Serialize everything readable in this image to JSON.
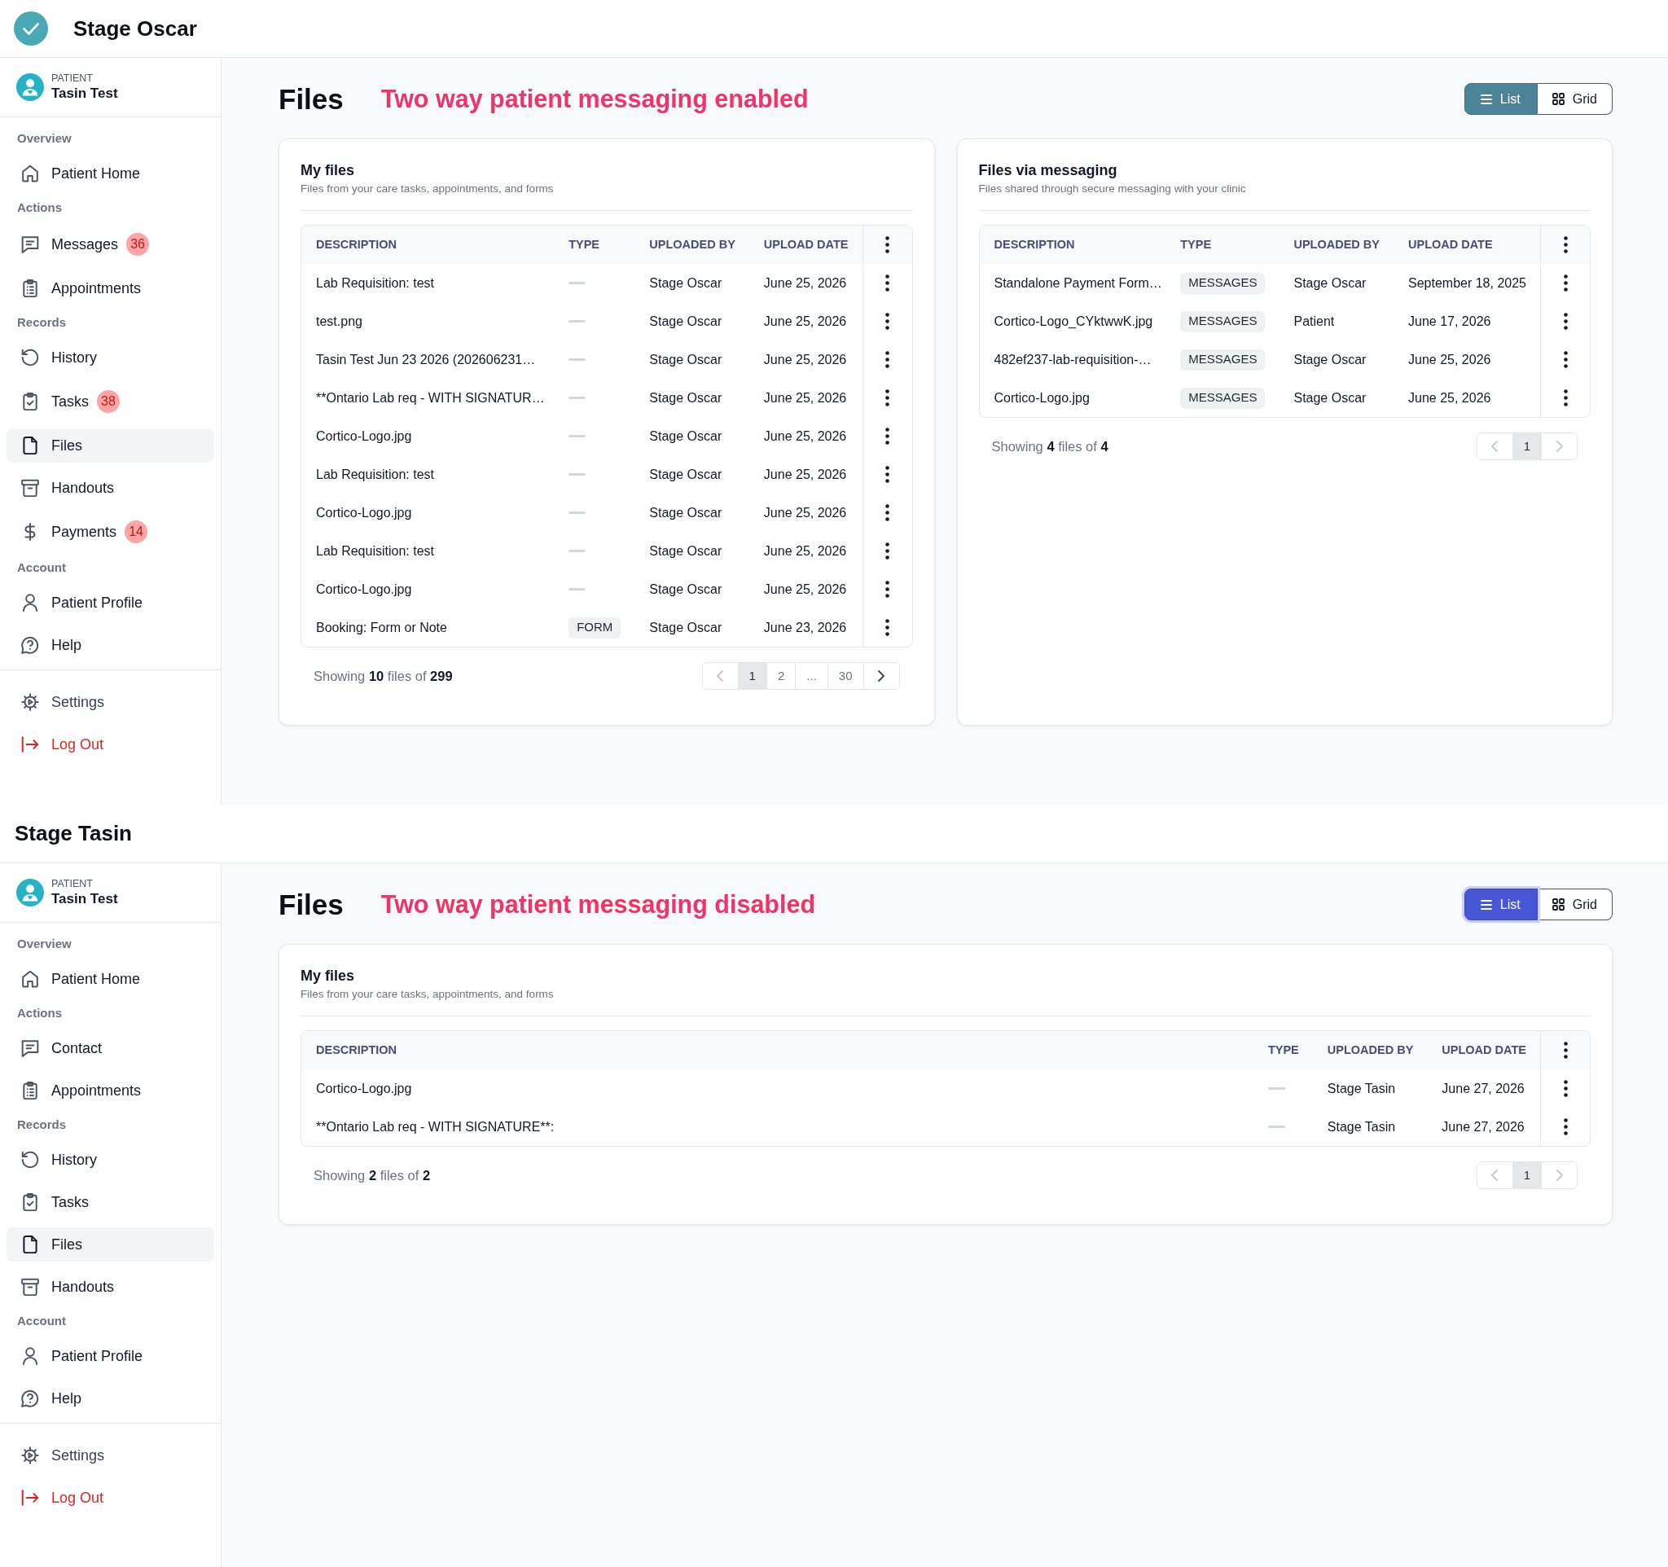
{
  "screens": [
    {
      "header": {
        "logo": true,
        "title": "Stage Oscar"
      },
      "sidebar": {
        "patient": {
          "role": "PATIENT",
          "name": "Tasin Test"
        },
        "sections": [
          {
            "label": "Overview",
            "items": [
              {
                "label": "Patient Home",
                "kind": "home",
                "selected": false
              }
            ]
          },
          {
            "label": "Actions",
            "items": [
              {
                "label": "Messages",
                "kind": "messages",
                "badge": "36",
                "selected": false
              },
              {
                "label": "Appointments",
                "kind": "appointments",
                "selected": false
              }
            ]
          },
          {
            "label": "Records",
            "items": [
              {
                "label": "History",
                "kind": "history",
                "selected": false
              },
              {
                "label": "Tasks",
                "kind": "tasks",
                "badge": "38",
                "selected": false
              },
              {
                "label": "Files",
                "kind": "files",
                "selected": true
              },
              {
                "label": "Handouts",
                "kind": "handouts",
                "selected": false
              },
              {
                "label": "Payments",
                "kind": "payments",
                "badge": "14",
                "selected": false
              }
            ]
          },
          {
            "label": "Account",
            "items": [
              {
                "label": "Patient Profile",
                "kind": "profile",
                "selected": false
              },
              {
                "label": "Help",
                "kind": "help",
                "selected": false
              }
            ]
          }
        ],
        "footer_items": [
          {
            "label": "Settings",
            "kind": "settings",
            "selected": false
          },
          {
            "label": "Log Out",
            "kind": "logout",
            "selected": false
          }
        ]
      },
      "page": {
        "title": "Files",
        "annotation": "Two way patient messaging enabled",
        "view_toggle": [
          {
            "label": "List",
            "kind": "list",
            "selected": true,
            "focused": false
          },
          {
            "label": "Grid",
            "kind": "grid",
            "selected": false,
            "focused": false
          }
        ],
        "cards": [
          {
            "title": "My files",
            "subtitle": "Files from your care tasks, appointments, and forms",
            "table": {
              "columns": [
                "DESCRIPTION",
                "TYPE",
                "UPLOADED BY",
                "UPLOAD DATE"
              ],
              "rows": [
                {
                  "description": "Lab Requisition: test",
                  "uploaded_by": "Stage Oscar",
                  "upload_date": "June 25, 2026"
                },
                {
                  "description": "test.png",
                  "uploaded_by": "Stage Oscar",
                  "upload_date": "June 25, 2026"
                },
                {
                  "description": "Tasin Test Jun 23 2026 (202606231…",
                  "uploaded_by": "Stage Oscar",
                  "upload_date": "June 25, 2026"
                },
                {
                  "description": "**Ontario Lab req - WITH SIGNATUR…",
                  "uploaded_by": "Stage Oscar",
                  "upload_date": "June 25, 2026"
                },
                {
                  "description": "Cortico-Logo.jpg",
                  "uploaded_by": "Stage Oscar",
                  "upload_date": "June 25, 2026"
                },
                {
                  "description": "Lab Requisition: test",
                  "uploaded_by": "Stage Oscar",
                  "upload_date": "June 25, 2026"
                },
                {
                  "description": "Cortico-Logo.jpg",
                  "uploaded_by": "Stage Oscar",
                  "upload_date": "June 25, 2026"
                },
                {
                  "description": "Lab Requisition: test",
                  "uploaded_by": "Stage Oscar",
                  "upload_date": "June 25, 2026"
                },
                {
                  "description": "Cortico-Logo.jpg",
                  "uploaded_by": "Stage Oscar",
                  "upload_date": "June 25, 2026"
                },
                {
                  "description": "Booking: Form or Note",
                  "type": "FORM",
                  "uploaded_by": "Stage Oscar",
                  "upload_date": "June 23, 2026"
                }
              ]
            },
            "summary": "Showing **10** files of **299**",
            "pagination": {
              "prev_disabled": true,
              "next_disabled": false,
              "pages": [
                {
                  "label": "1",
                  "selected": true
                },
                {
                  "label": "2",
                  "selected": false
                },
                {
                  "label": "...",
                  "selected": false
                },
                {
                  "label": "30",
                  "selected": false
                }
              ]
            }
          },
          {
            "title": "Files via messaging",
            "subtitle": "Files shared through secure messaging with your clinic",
            "table": {
              "columns": [
                "DESCRIPTION",
                "TYPE",
                "UPLOADED BY",
                "UPLOAD DATE"
              ],
              "rows": [
                {
                  "description": "Standalone Payment Form…",
                  "type": "MESSAGES",
                  "uploaded_by": "Stage Oscar",
                  "upload_date": "September 18, 2025"
                },
                {
                  "description": "Cortico-Logo_CYktwwK.jpg",
                  "type": "MESSAGES",
                  "uploaded_by": "Patient",
                  "upload_date": "June 17, 2026"
                },
                {
                  "description": "482ef237-lab-requisition-…",
                  "type": "MESSAGES",
                  "uploaded_by": "Stage Oscar",
                  "upload_date": "June 25, 2026"
                },
                {
                  "description": "Cortico-Logo.jpg",
                  "type": "MESSAGES",
                  "uploaded_by": "Stage Oscar",
                  "upload_date": "June 25, 2026"
                }
              ]
            },
            "summary": "Showing **4** files of **4**",
            "pagination": {
              "prev_disabled": true,
              "next_disabled": true,
              "pages": [
                {
                  "label": "1",
                  "selected": true
                }
              ]
            }
          }
        ]
      }
    },
    {
      "header": {
        "logo": false,
        "title": "Stage Tasin"
      },
      "sidebar": {
        "patient": {
          "role": "PATIENT",
          "name": "Tasin Test"
        },
        "sections": [
          {
            "label": "Overview",
            "items": [
              {
                "label": "Patient Home",
                "kind": "home",
                "selected": false
              }
            ]
          },
          {
            "label": "Actions",
            "items": [
              {
                "label": "Contact",
                "kind": "contact",
                "selected": false
              },
              {
                "label": "Appointments",
                "kind": "appointments",
                "selected": false
              }
            ]
          },
          {
            "label": "Records",
            "items": [
              {
                "label": "History",
                "kind": "history",
                "selected": false
              },
              {
                "label": "Tasks",
                "kind": "tasks",
                "selected": false
              },
              {
                "label": "Files",
                "kind": "files",
                "selected": true
              },
              {
                "label": "Handouts",
                "kind": "handouts",
                "selected": false
              }
            ]
          },
          {
            "label": "Account",
            "items": [
              {
                "label": "Patient Profile",
                "kind": "profile",
                "selected": false
              },
              {
                "label": "Help",
                "kind": "help",
                "selected": false
              }
            ]
          }
        ],
        "footer_items": [
          {
            "label": "Settings",
            "kind": "settings",
            "selected": false
          },
          {
            "label": "Log Out",
            "kind": "logout",
            "selected": false
          }
        ]
      },
      "page": {
        "title": "Files",
        "annotation": "Two way patient messaging disabled",
        "view_toggle": [
          {
            "label": "List",
            "kind": "list",
            "selected": true,
            "focused": true
          },
          {
            "label": "Grid",
            "kind": "grid",
            "selected": false,
            "focused": false
          }
        ],
        "cards": [
          {
            "title": "My files",
            "subtitle": "Files from your care tasks, appointments, and forms",
            "table": {
              "columns": [
                "DESCRIPTION",
                "TYPE",
                "UPLOADED BY",
                "UPLOAD DATE"
              ],
              "rows": [
                {
                  "description": "Cortico-Logo.jpg",
                  "uploaded_by": "Stage Tasin",
                  "upload_date": "June 27, 2026"
                },
                {
                  "description": "**Ontario Lab req - WITH SIGNATURE**:",
                  "uploaded_by": "Stage Tasin",
                  "upload_date": "June 27, 2026"
                }
              ]
            },
            "summary": "Showing **2** files of **2**",
            "pagination": {
              "prev_disabled": true,
              "next_disabled": true,
              "pages": [
                {
                  "label": "1",
                  "selected": true
                }
              ]
            }
          }
        ]
      }
    }
  ]
}
